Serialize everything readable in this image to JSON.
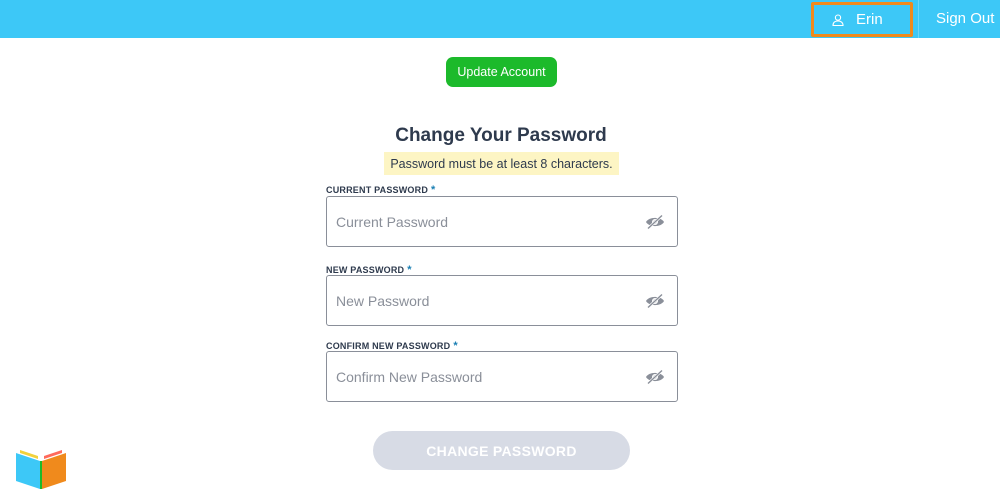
{
  "header": {
    "user_name": "Erin",
    "sign_out_label": "Sign Out",
    "bar_color": "#3dc8f7",
    "focus_color": "#f08a1c"
  },
  "update_account_label": "Update Account",
  "form": {
    "title": "Change Your Password",
    "hint": "Password must be at least 8 characters.",
    "fields": [
      {
        "label": "CURRENT PASSWORD",
        "required_mark": "*",
        "placeholder": "Current Password",
        "value": ""
      },
      {
        "label": "NEW PASSWORD",
        "required_mark": "*",
        "placeholder": "New Password",
        "value": ""
      },
      {
        "label": "CONFIRM NEW PASSWORD",
        "required_mark": "*",
        "placeholder": "Confirm New Password",
        "value": ""
      }
    ],
    "submit_label": "CHANGE PASSWORD"
  },
  "icons": {
    "user": "user-icon",
    "eye": "eye-slash-icon",
    "logo": "book-logo-icon"
  }
}
